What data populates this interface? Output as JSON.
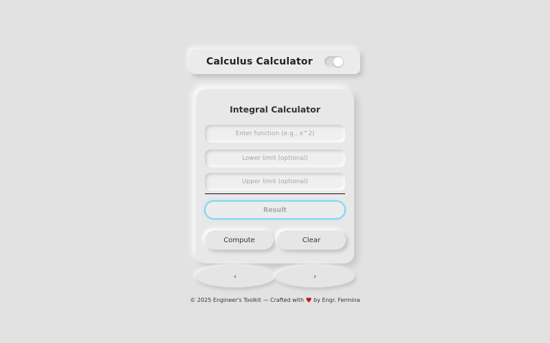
{
  "header": {
    "title": "Calculus Calculator",
    "toggle_state": "on"
  },
  "card": {
    "title": "Integral Calculator",
    "function_placeholder": "Enter function (e.g., x^2)",
    "lower_placeholder": "Lower limit (optional)",
    "upper_placeholder": "Upper limit (optional)",
    "result_label": "Result",
    "compute_label": "Compute",
    "clear_label": "Clear"
  },
  "nav": {
    "prev_label": "‹",
    "next_label": "›"
  },
  "footer": {
    "text_before": "© 2025 Engineer's Toolkit — Crafted with",
    "heart_glyph": "♥",
    "text_after": "by Engr. Fermina"
  },
  "colors": {
    "background": "#e2e2e2",
    "result_border": "#7fd7ec",
    "heart": "#c0141c"
  }
}
